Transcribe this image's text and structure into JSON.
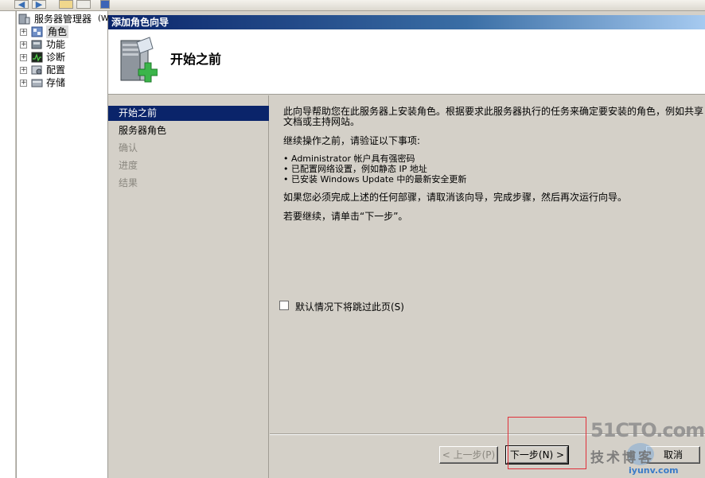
{
  "tree": {
    "root_label": "服务器管理器",
    "root_suffix": "(W:",
    "items": [
      {
        "label": "角色",
        "selected": true
      },
      {
        "label": "功能"
      },
      {
        "label": "诊断"
      },
      {
        "label": "配置"
      },
      {
        "label": "存储"
      }
    ],
    "expand_glyph": "+"
  },
  "wizard": {
    "window_title": "添加角色向导",
    "page_title": "开始之前",
    "steps": [
      {
        "label": "开始之前",
        "state": "active"
      },
      {
        "label": "服务器角色",
        "state": "normal"
      },
      {
        "label": "确认",
        "state": "disabled"
      },
      {
        "label": "进度",
        "state": "disabled"
      },
      {
        "label": "结果",
        "state": "disabled"
      }
    ],
    "intro": "此向导帮助您在此服务器上安装角色。根据要求此服务器执行的任务来确定要安装的角色，例如共享\n文档或主持网站。",
    "verify_heading": "继续操作之前，请验证以下事项:",
    "bullets": [
      "• Administrator 帐户具有强密码",
      "• 已配置网络设置，例如静态 IP 地址",
      "• 已安装 Windows Update 中的最新安全更新"
    ],
    "cancel_note": "如果您必须完成上述的任何部骤，请取消该向导，完成步骤，然后再次运行向导。",
    "continue_note": "若要继续，请单击“下一步”。",
    "skip_checkbox_label": "默认情况下将跳过此页(S)",
    "skip_checked": false,
    "buttons": {
      "back": "< 上一步(P)",
      "next": "下一步(N) >",
      "cancel": "取消"
    }
  },
  "watermark": {
    "line1": "51CTO.com",
    "line2": "技术博客",
    "line3": "iyunv.com"
  },
  "colors": {
    "title_bar_start": "#0a246a",
    "selection": "#0a246a",
    "annotation_box": "#e0303a"
  }
}
